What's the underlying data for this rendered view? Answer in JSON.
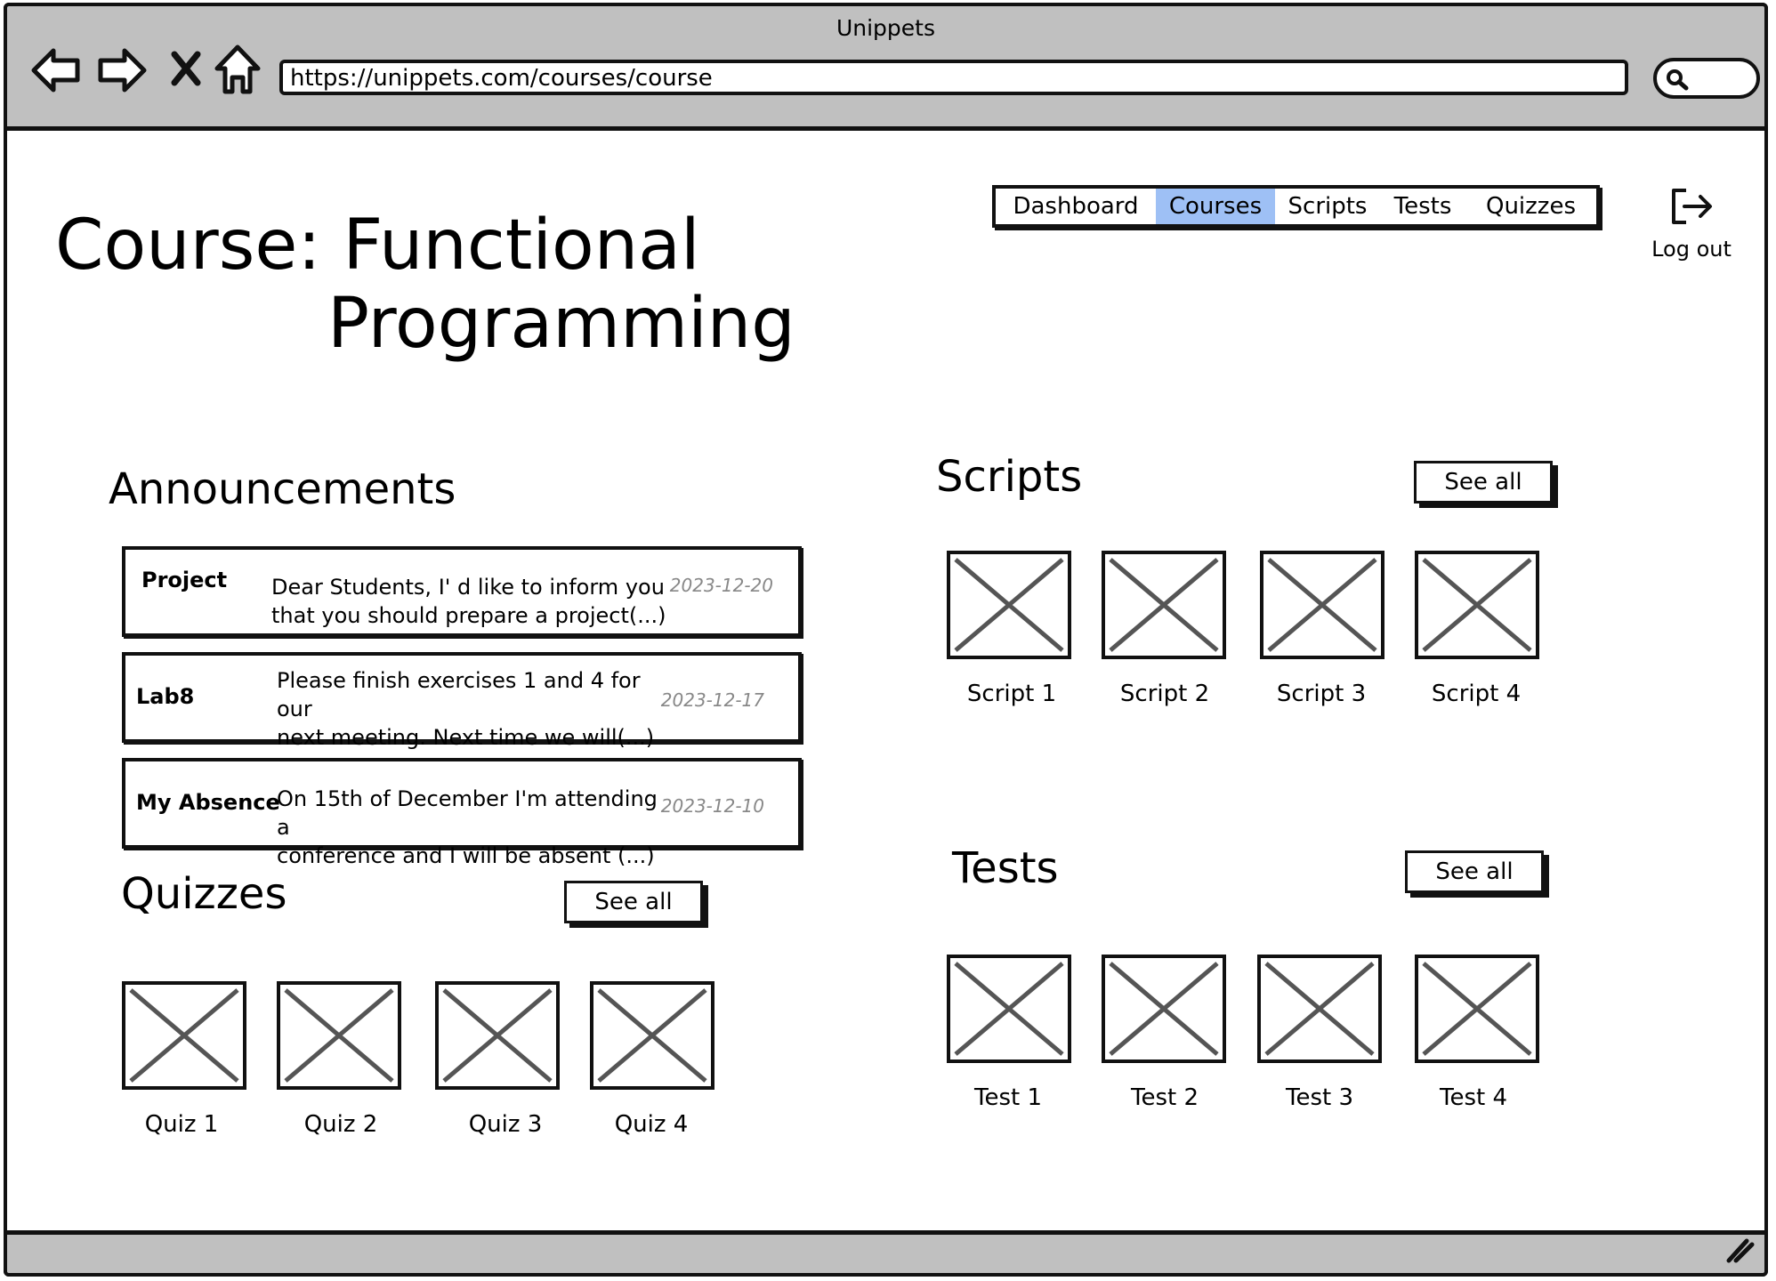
{
  "browser": {
    "title": "Unippets",
    "url": "https://unippets.com/courses/course",
    "icons": [
      "back-arrow-icon",
      "forward-arrow-icon",
      "stop-icon",
      "home-icon",
      "search-icon",
      "resize-handle-icon"
    ]
  },
  "nav": {
    "tabs": [
      {
        "label": "Dashboard",
        "active": false
      },
      {
        "label": "Courses",
        "active": true
      },
      {
        "label": "Scripts",
        "active": false
      },
      {
        "label": "Tests",
        "active": false
      },
      {
        "label": "Quizzes",
        "active": false
      }
    ],
    "logout_label": "Log out",
    "active_color": "#9ec0f5"
  },
  "page": {
    "title_line1": "Course: Functional",
    "title_line2": "Programming"
  },
  "announcements": {
    "heading": "Announcements",
    "items": [
      {
        "title": "Project",
        "body_line1": "Dear Students, I' d like to inform you",
        "body_line2": "that you should prepare a project(...)",
        "date": "2023-12-20"
      },
      {
        "title": "Lab8",
        "body_line1": "Please finish exercises 1 and 4 for our",
        "body_line2": "next meeting. Next time we will(...)",
        "date": "2023-12-17"
      },
      {
        "title": "My Absence",
        "body_line1": "On 15th of December I'm attending a",
        "body_line2": "conference and I will be absent (...)",
        "date": "2023-12-10"
      }
    ]
  },
  "quizzes": {
    "heading": "Quizzes",
    "see_all": "See all",
    "items": [
      "Quiz 1",
      "Quiz 2",
      "Quiz 3",
      "Quiz 4"
    ]
  },
  "scripts": {
    "heading": "Scripts",
    "see_all": "See all",
    "items": [
      "Script 1",
      "Script 2",
      "Script 3",
      "Script 4"
    ]
  },
  "tests": {
    "heading": "Tests",
    "see_all": "See all",
    "items": [
      "Test 1",
      "Test 2",
      "Test 3",
      "Test 4"
    ]
  }
}
